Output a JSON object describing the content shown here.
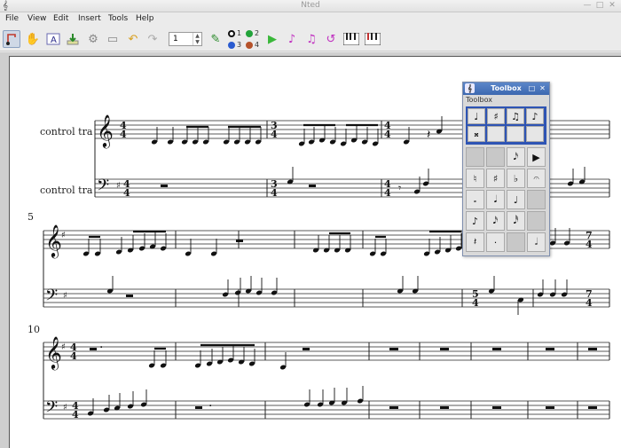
{
  "window": {
    "title": "Nted",
    "app_icon": "nted-logo-icon"
  },
  "menubar": {
    "items": [
      "File",
      "View",
      "Edit",
      "Insert",
      "Tools",
      "Help"
    ]
  },
  "toolbar": {
    "spin_value": "1",
    "voices": [
      {
        "label": "1",
        "color": "#111111"
      },
      {
        "label": "2",
        "color": "#22a33a"
      },
      {
        "label": "3",
        "color": "#2a5bd0"
      },
      {
        "label": "4",
        "color": "#b5522a"
      }
    ]
  },
  "score": {
    "staff_labels": [
      "control tra",
      "control tra"
    ],
    "measure_numbers": [
      "5",
      "10"
    ],
    "time_sig_top": "4",
    "time_sig_bottom": "4",
    "alt_time_top_1": "3",
    "alt_time_bottom_1": "4",
    "alt_time_top_2": "5",
    "alt_time_bottom_2": "4",
    "alt_time_top_3": "7",
    "alt_time_bottom_3": "4"
  },
  "toolbox": {
    "title": "Toolbox",
    "subtitle": "Toolbox",
    "top_cells": [
      "♩",
      "♯",
      "♫",
      "♪",
      "𝄪",
      "",
      "",
      ""
    ],
    "bottom_cells": [
      "",
      "",
      "𝅘𝅥𝅯",
      "▶",
      "♮",
      "♯",
      "♭",
      "𝄐",
      "𝅗",
      "𝅘𝅥",
      "♩",
      "",
      "♪",
      "𝅘𝅥𝅯",
      "𝅘𝅥𝅰",
      "",
      "𝄽",
      "·",
      "",
      "𝅗𝅥"
    ]
  }
}
